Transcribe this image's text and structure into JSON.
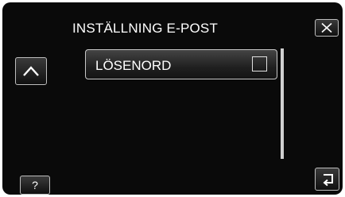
{
  "screen": {
    "title": "INSTÄLLNING E-POST"
  },
  "list": {
    "items": [
      {
        "label": "LÖSENORD",
        "checked": false
      }
    ]
  },
  "buttons": {
    "close_icon": "close-icon",
    "up_icon": "chevron-up-icon",
    "help_label": "?",
    "back_icon": "return-arrow-icon"
  },
  "colors": {
    "background": "#0a0a0a",
    "border": "#c8c8c8",
    "text": "#ffffff"
  }
}
